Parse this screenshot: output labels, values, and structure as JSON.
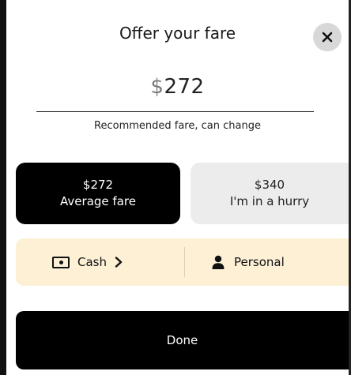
{
  "header": {
    "title": "Offer your fare",
    "close_icon": "close-icon"
  },
  "fare": {
    "currency": "$",
    "amount": "272",
    "hint": "Recommended fare, can change"
  },
  "options": [
    {
      "price": "$272",
      "label": "Average fare",
      "selected": true
    },
    {
      "price": "$340",
      "label": "I'm in a hurry",
      "selected": false
    }
  ],
  "payment": {
    "method_label": "Cash",
    "method_icon": "cash-icon",
    "profile_label": "Personal",
    "profile_icon": "person-icon"
  },
  "footer": {
    "done_label": "Done"
  },
  "colors": {
    "selected_bg": "#000000",
    "option_bg": "#ececec",
    "payment_bg": "#fdf0d5",
    "close_bg": "#d8d8d8"
  }
}
